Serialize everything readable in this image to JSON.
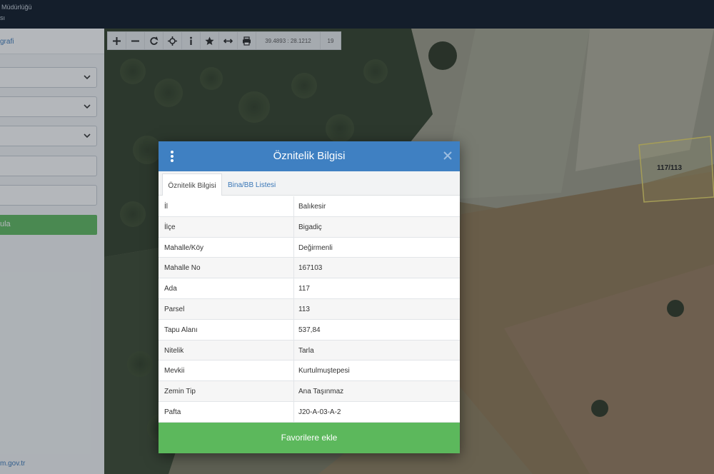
{
  "header": {
    "title_line1": "Müdürlüğü",
    "title_line2": "sı"
  },
  "sidebar": {
    "tab_label": "grafi",
    "button_label": "ula",
    "footer_link": "m.gov.tr"
  },
  "map_toolbar": {
    "coordinates": "39.4893 : 28.1212",
    "zoom": "19"
  },
  "parcel_label": "117/113",
  "modal": {
    "title": "Öznitelik Bilgisi",
    "tabs": [
      {
        "label": "Öznitelik Bilgisi"
      },
      {
        "label": "Bina/BB Listesi"
      }
    ],
    "rows": [
      {
        "key": "İl",
        "value": "Balıkesir"
      },
      {
        "key": "İlçe",
        "value": "Bigadiç"
      },
      {
        "key": "Mahalle/Köy",
        "value": "Değirmenli"
      },
      {
        "key": "Mahalle No",
        "value": "167103"
      },
      {
        "key": "Ada",
        "value": "117"
      },
      {
        "key": "Parsel",
        "value": "113"
      },
      {
        "key": "Tapu Alanı",
        "value": "537,84"
      },
      {
        "key": "Nitelik",
        "value": "Tarla"
      },
      {
        "key": "Mevkii",
        "value": "Kurtulmuştepesi"
      },
      {
        "key": "Zemin Tip",
        "value": "Ana Taşınmaz"
      },
      {
        "key": "Pafta",
        "value": "J20-A-03-A-2"
      }
    ],
    "footer_button": "Favorilere ekle"
  },
  "colors": {
    "header_bg": "#0a1523",
    "modal_header": "#3f80c2",
    "accent_green": "#5cb85c",
    "link_blue": "#3a77b7"
  }
}
